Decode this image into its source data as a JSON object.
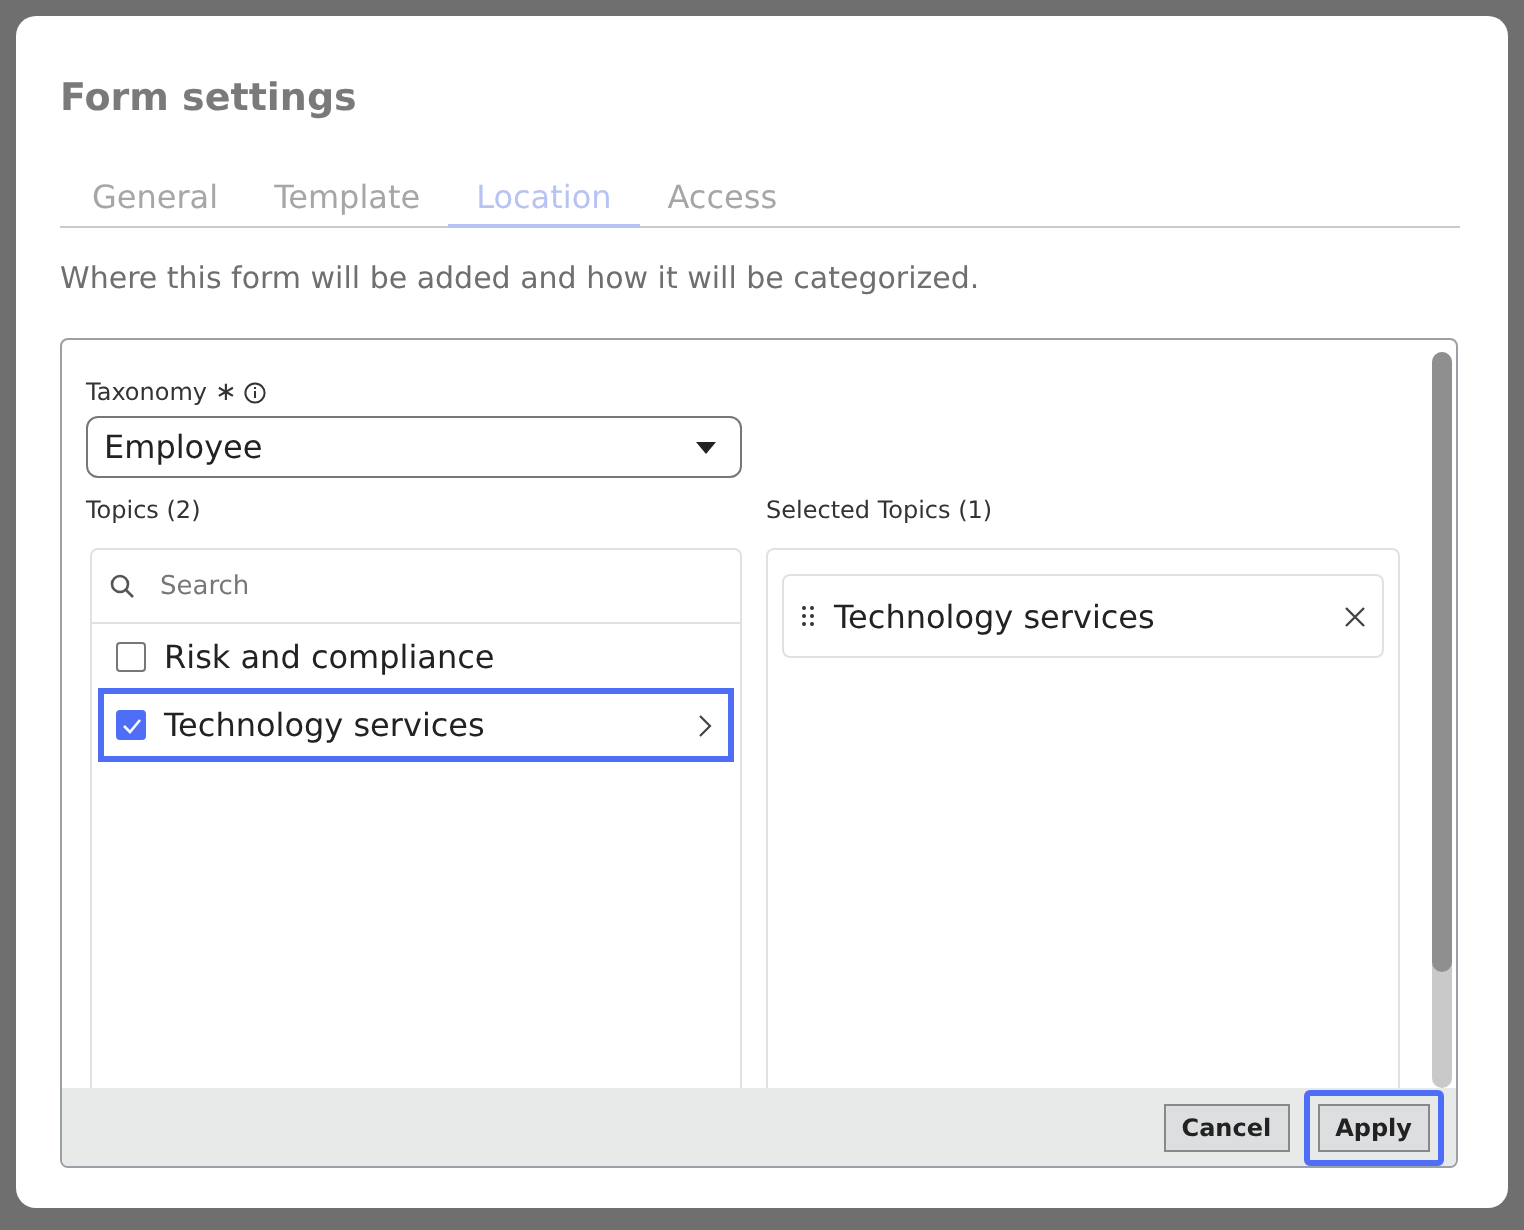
{
  "dialog": {
    "title": "Form settings",
    "tabs": [
      {
        "label": "General",
        "selected": false
      },
      {
        "label": "Template",
        "selected": false
      },
      {
        "label": "Location",
        "selected": true
      },
      {
        "label": "Access",
        "selected": false
      }
    ],
    "description": "Where this form will be added and how it will be categorized.",
    "taxonomy": {
      "label": "Taxonomy",
      "required_mark": "∗",
      "value": "Employee"
    },
    "topics": {
      "label": "Topics (2)",
      "search_placeholder": "Search",
      "items": [
        {
          "label": "Risk and compliance",
          "checked": false,
          "focused": false,
          "has_children": false
        },
        {
          "label": "Technology services",
          "checked": true,
          "focused": true,
          "has_children": true
        }
      ]
    },
    "selected_topics": {
      "label": "Selected Topics (1)",
      "items": [
        {
          "label": "Technology services"
        }
      ]
    },
    "buttons": [
      {
        "label": "Cancel",
        "focused": false
      },
      {
        "label": "Apply",
        "focused": true
      }
    ]
  }
}
